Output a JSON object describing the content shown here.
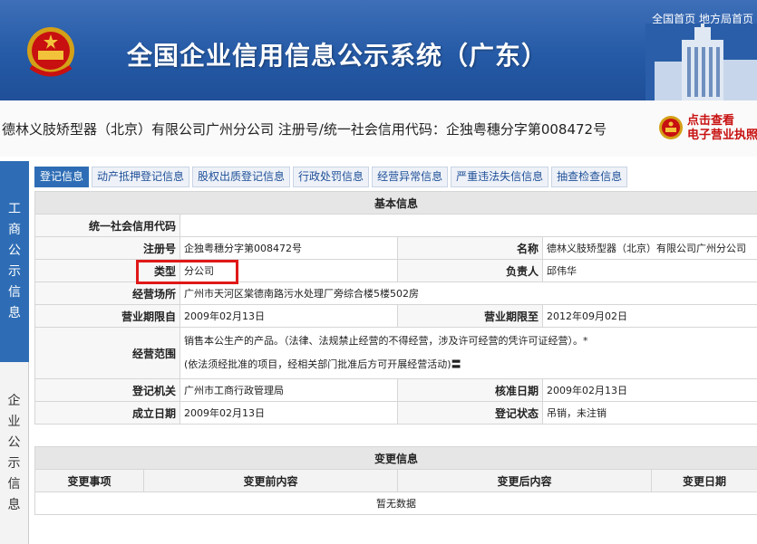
{
  "header": {
    "site_title": "全国企业信用信息公示系统（广东）",
    "link_home": "全国首页",
    "link_local": "地方局首页"
  },
  "company_line": "德林义肢矫型器（北京）有限公司广州分公司   注册号/统一社会信用代码：企独粤穗分字第008472号",
  "ebadge": {
    "line1": "点击查看",
    "line2": "电子营业执照"
  },
  "sidenav": {
    "active": "工商公示信息",
    "inactive": "企业公示信息"
  },
  "tabs": [
    "登记信息",
    "动产抵押登记信息",
    "股权出质登记信息",
    "行政处罚信息",
    "经营异常信息",
    "严重违法失信信息",
    "抽查检查信息"
  ],
  "basic": {
    "section_title": "基本信息",
    "credit_code_label": "统一社会信用代码",
    "credit_code_value": "",
    "reg_no_label": "注册号",
    "reg_no_value": "企独粤穗分字第008472号",
    "name_label": "名称",
    "name_value": "德林义肢矫型器（北京）有限公司广州分公司",
    "type_label": "类型",
    "type_value": "分公司",
    "leader_label": "负责人",
    "leader_value": "邱伟华",
    "address_label": "经营场所",
    "address_value": "广州市天河区棠德南路污水处理厂旁综合楼5楼502房",
    "term_from_label": "营业期限自",
    "term_from_value": "2009年02月13日",
    "term_to_label": "营业期限至",
    "term_to_value": "2012年09月02日",
    "scope_label": "经营范围",
    "scope_line1": "销售本公生产的产品。（法律、法规禁止经营的不得经营，涉及许可经营的凭许可证经营）。*",
    "scope_line2": "(依法须经批准的项目，经相关部门批准后方可开展经营活动)〓",
    "authority_label": "登记机关",
    "authority_value": "广州市工商行政管理局",
    "approve_label": "核准日期",
    "approve_value": "2009年02月13日",
    "founded_label": "成立日期",
    "founded_value": "2009年02月13日",
    "status_label": "登记状态",
    "status_value": "吊销，未注销"
  },
  "changes": {
    "section_title": "变更信息",
    "headers": [
      "变更事项",
      "变更前内容",
      "变更后内容",
      "变更日期"
    ],
    "empty_text": "暂无数据"
  },
  "colors": {
    "header_blue": "#255aa6",
    "active_tab": "#2e6db5",
    "highlight": "#e01818"
  }
}
